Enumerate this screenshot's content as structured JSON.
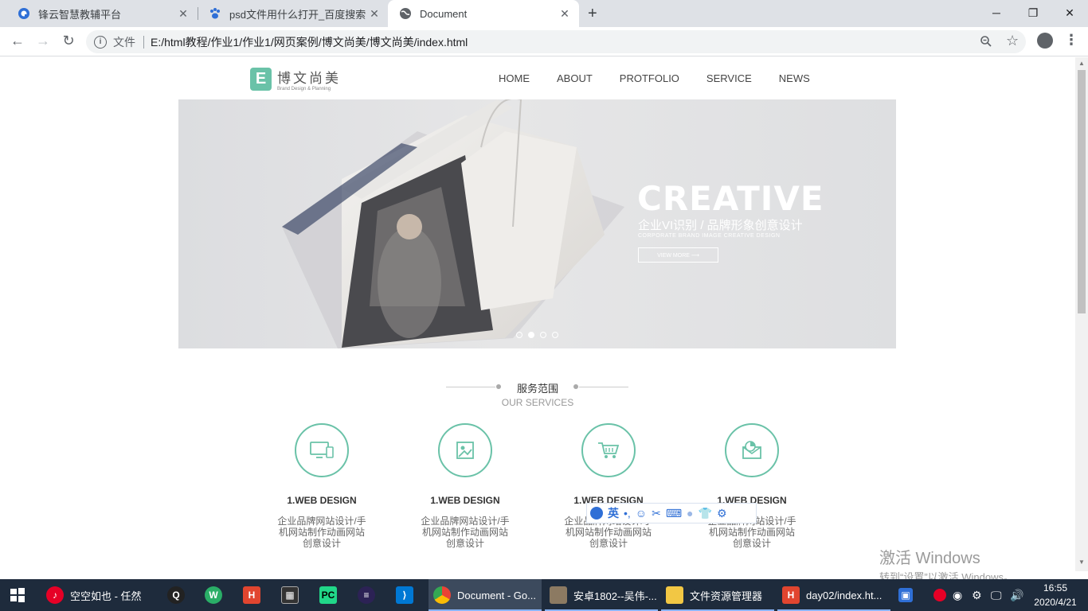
{
  "browser": {
    "tabs": [
      {
        "title": "锋云智慧教辅平台",
        "icon": "fengyun-favicon"
      },
      {
        "title": "psd文件用什么打开_百度搜索",
        "icon": "baidu-paw-favicon"
      },
      {
        "title": "Document",
        "icon": "globe-favicon"
      }
    ],
    "close_glyph": "✕",
    "new_tab_glyph": "+",
    "scheme_label": "文件",
    "url": "E:/html教程/作业1/作业1/网页案例/博文尚美/博文尚美/index.html"
  },
  "site": {
    "logo_letter": "E",
    "logo_cn": "博文尚美",
    "logo_en": "Brand Design & Planning",
    "nav": [
      "HOME",
      "ABOUT",
      "PROTFOLIO",
      "SERVICE",
      "NEWS"
    ],
    "banner": {
      "headline": "CREATIVE",
      "subtitle": "企业VI识别 / 品牌形象创意设计",
      "english": "CORPORATE BRAND IMAGE CREATIVE DESIGN",
      "button": "VIEW MORE ⟶",
      "slide_count": 4,
      "active_slide": 2
    },
    "services": {
      "title_cn": "服务范围",
      "title_en": "OUR SERVICES",
      "items": [
        {
          "name": "1.WEB DESIGN",
          "desc": "企业品牌网站设计/手机网站制作动画网站创意设计",
          "icon": "monitor-phone-icon"
        },
        {
          "name": "1.WEB DESIGN",
          "desc": "企业品牌网站设计/手机网站制作动画网站创意设计",
          "icon": "picture-icon"
        },
        {
          "name": "1.WEB DESIGN",
          "desc": "企业品牌网站设计/手机网站制作动画网站创意设计",
          "icon": "shopping-cart-icon"
        },
        {
          "name": "1.WEB DESIGN",
          "desc": "企业品牌网站设计/手机网站制作动画网站创意设计",
          "icon": "mail-chart-icon"
        }
      ]
    }
  },
  "ime": {
    "mode": "英"
  },
  "watermark": {
    "line1": "激活 Windows",
    "line2": "转到“设置”以激活 Windows。"
  },
  "taskbar": {
    "apps": [
      {
        "label": "空空如也 - 任然",
        "icon": "netease-music-icon"
      },
      {
        "label": "",
        "icon": "qq-icon"
      },
      {
        "label": "",
        "icon": "wechat-icon"
      },
      {
        "label": "",
        "icon": "hbuilder-icon"
      },
      {
        "label": "",
        "icon": "film-icon"
      },
      {
        "label": "",
        "icon": "pycharm-icon"
      },
      {
        "label": "",
        "icon": "eclipse-icon"
      },
      {
        "label": "",
        "icon": "vscode-icon"
      },
      {
        "label": "Document - Go...",
        "icon": "chrome-icon"
      },
      {
        "label": "安卓1802--吴伟-...",
        "icon": "avatar-icon"
      },
      {
        "label": "文件资源管理器",
        "icon": "folder-icon"
      },
      {
        "label": "day02/index.ht...",
        "icon": "hbuilder-icon"
      }
    ],
    "time": "16:55",
    "date": "2020/4/21"
  },
  "colors": {
    "accent": "#6ac2a8",
    "taskbar": "#1e2b3c",
    "chrome_bg": "#dee1e6"
  }
}
